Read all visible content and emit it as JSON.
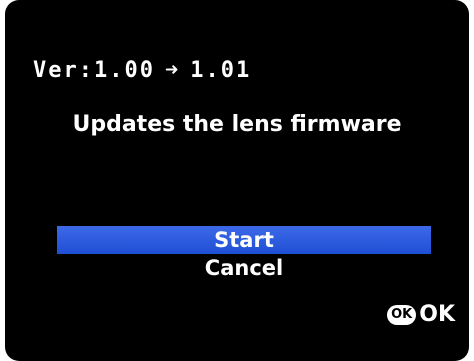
{
  "version": {
    "prefix": "Ver:",
    "current": "1.00",
    "arrow_icon": "right-arrow-icon",
    "arrow_glyph": "➜",
    "new": "1.01"
  },
  "description": "Updates the lens firmware",
  "menu": {
    "items": [
      {
        "label": "Start",
        "selected": true
      },
      {
        "label": "Cancel",
        "selected": false
      }
    ],
    "highlight_color": "#2a5be0"
  },
  "footer": {
    "ok_badge": "OK",
    "ok_label": "OK"
  }
}
